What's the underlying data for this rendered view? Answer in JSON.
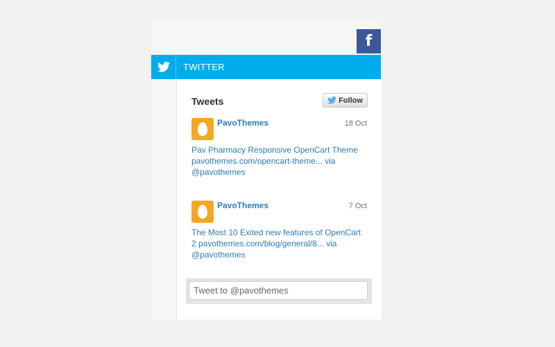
{
  "colors": {
    "facebook": "#3b5998",
    "twitter": "#00aced",
    "link": "#2b7bb9",
    "avatar": "#f5a623"
  },
  "social": {
    "facebook_icon": "facebook-f-icon",
    "facebook_glyph": "f",
    "twitter_icon": "twitter-bird-icon",
    "twitter_label": "TWITTER"
  },
  "widget": {
    "heading": "Tweets",
    "follow_label": "Follow",
    "tweets": [
      {
        "author": "PavoThemes",
        "date": "18 Oct",
        "lines": [
          "Pav Pharmacy Responsive OpenCart Theme",
          "pavothemes.com/opencart-theme... via",
          "@pavothemes"
        ]
      },
      {
        "author": "PavoThemes",
        "date": "7 Oct",
        "lines": [
          "The Most 10 Exited new features of OpenCart",
          "2 pavothemes.com/blog/general/8... via",
          "@pavothemes"
        ]
      }
    ],
    "tweet_box_placeholder": "Tweet to @pavothemes"
  }
}
